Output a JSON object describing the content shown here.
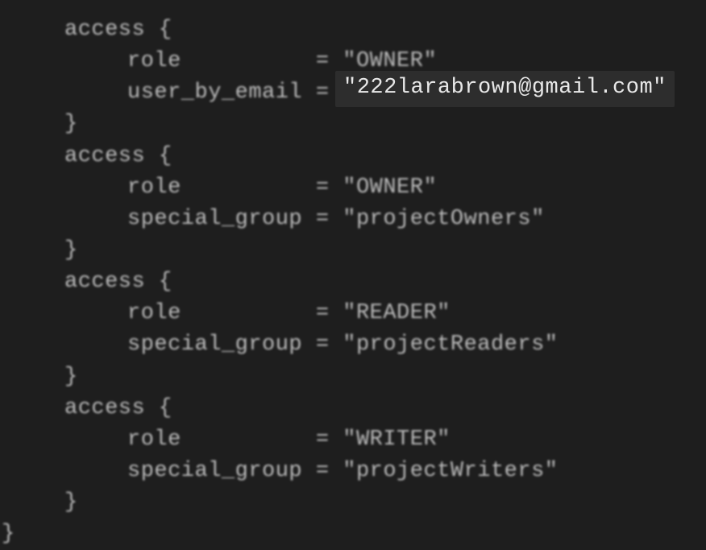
{
  "blocks": [
    {
      "keyword": "access",
      "fields": [
        {
          "key": "role",
          "padded": "role         ",
          "value": "\"OWNER\""
        },
        {
          "key": "user_by_email",
          "padded": "user_by_email",
          "value": ""
        }
      ]
    },
    {
      "keyword": "access",
      "fields": [
        {
          "key": "role",
          "padded": "role         ",
          "value": "\"OWNER\""
        },
        {
          "key": "special_group",
          "padded": "special_group",
          "value": "\"projectOwners\""
        }
      ]
    },
    {
      "keyword": "access",
      "fields": [
        {
          "key": "role",
          "padded": "role         ",
          "value": "\"READER\""
        },
        {
          "key": "special_group",
          "padded": "special_group",
          "value": "\"projectReaders\""
        }
      ]
    },
    {
      "keyword": "access",
      "fields": [
        {
          "key": "role",
          "padded": "role         ",
          "value": "\"WRITER\""
        },
        {
          "key": "special_group",
          "padded": "special_group",
          "value": "\"projectWriters\""
        }
      ]
    }
  ],
  "closing_brace": "}",
  "highlight": "\"222larabrown@gmail.com\""
}
